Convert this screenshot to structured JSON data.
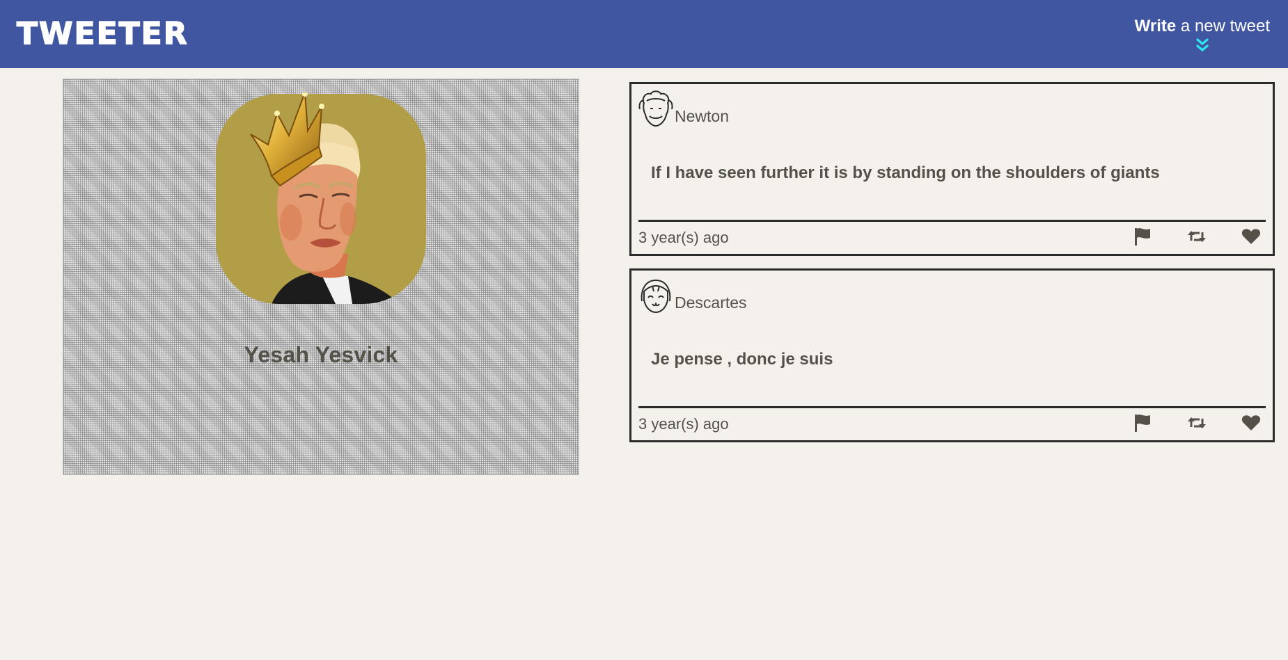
{
  "header": {
    "logo": "TWEETER",
    "compose_bold": "Write",
    "compose_rest": "a new tweet"
  },
  "profile": {
    "name": "Yesah Yesvick"
  },
  "tweets": [
    {
      "author": "Newton",
      "content": "If I have seen further it is by standing on the shoulders of giants",
      "time": "3 year(s) ago"
    },
    {
      "author": "Descartes",
      "content": "Je pense , donc je suis",
      "time": "3 year(s) ago"
    }
  ],
  "icons": {
    "compose": "double-chevron-down-icon",
    "flag": "flag-icon",
    "retweet": "retweet-icon",
    "like": "heart-icon"
  },
  "colors": {
    "nav": "#4056a1",
    "background": "#f4f1ec",
    "text": "#545149",
    "accent": "#2ee6f0",
    "avatar_bg": "#b39e48"
  }
}
